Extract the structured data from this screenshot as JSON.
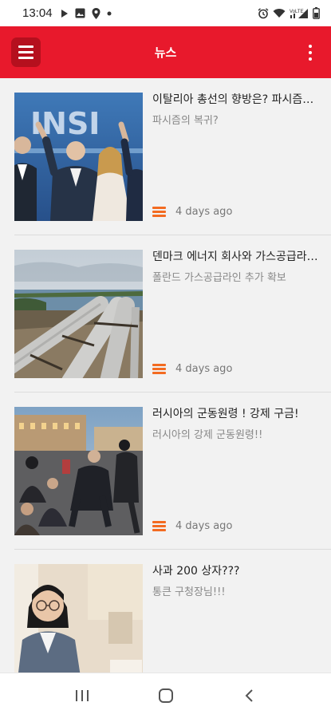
{
  "status_bar": {
    "time": "13:04",
    "left_icons": [
      "play-icon",
      "gallery-icon",
      "location-icon",
      "dot-icon"
    ],
    "right_icons": [
      "alarm-icon",
      "wifi-icon",
      "signal-icon",
      "battery-icon"
    ],
    "network_label": "VoLTE"
  },
  "app_bar": {
    "title": "뉴스",
    "menu_icon": "hamburger-menu-icon",
    "more_icon": "more-vertical-icon",
    "accent_color": "#e8192c"
  },
  "articles": [
    {
      "title": "이탈리아 총선의 향방은? 파시즘의 복귀?",
      "subtitle": "파시즘의 복귀?",
      "date": "4 days ago"
    },
    {
      "title": "덴마크 에너지 회사와 가스공급라인 추가 확보",
      "subtitle": "폴란드 가스공급라인 추가 확보",
      "date": "4 days ago"
    },
    {
      "title": "러시아의 군동원령 ! 강제 구금!",
      "subtitle": "러시아의 강제 군동원령!!",
      "date": "4 days ago"
    },
    {
      "title": "사과 200 상자???",
      "subtitle": "통큰 구청장님!!!",
      "date": ""
    }
  ],
  "nav_bar": {
    "buttons": [
      "recent-apps-icon",
      "home-icon",
      "back-icon"
    ]
  }
}
